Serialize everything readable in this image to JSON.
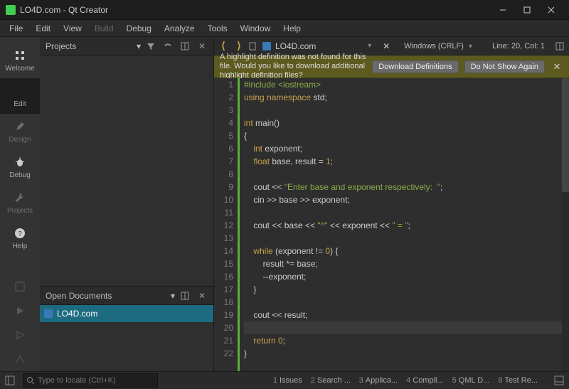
{
  "window": {
    "title": "LO4D.com - Qt Creator"
  },
  "menu": {
    "items": [
      "File",
      "Edit",
      "View",
      "Build",
      "Debug",
      "Analyze",
      "Tools",
      "Window",
      "Help"
    ],
    "disabled_index": 3
  },
  "sidebar": {
    "modes": [
      {
        "id": "welcome",
        "label": "Welcome",
        "icon": "grid-icon",
        "active": false,
        "disabled": false
      },
      {
        "id": "edit",
        "label": "Edit",
        "icon": "pencil-icon",
        "active": true,
        "disabled": false
      },
      {
        "id": "design",
        "label": "Design",
        "icon": "brush-icon",
        "active": false,
        "disabled": true
      },
      {
        "id": "debug",
        "label": "Debug",
        "icon": "bug-icon",
        "active": false,
        "disabled": false
      },
      {
        "id": "projects",
        "label": "Projects",
        "icon": "wrench-icon",
        "active": false,
        "disabled": true
      },
      {
        "id": "help",
        "label": "Help",
        "icon": "help-icon",
        "active": false,
        "disabled": false
      }
    ]
  },
  "projectsPanel": {
    "title": "Projects"
  },
  "openDocs": {
    "title": "Open Documents",
    "items": [
      {
        "name": "LO4D.com"
      }
    ]
  },
  "editor": {
    "filename": "LO4D.com",
    "encoding": "Windows (CRLF)",
    "cursor": "Line: 20, Col: 1",
    "current_line_index": 19
  },
  "notification": {
    "message": "A highlight definition was not found for this file. Would you like to download additional highlight definition files?",
    "btn_download": "Download Definitions",
    "btn_dismiss": "Do Not Show Again"
  },
  "code": {
    "lines": [
      {
        "n": 1,
        "tokens": [
          [
            "pp",
            "#include <iostream>"
          ]
        ]
      },
      {
        "n": 2,
        "tokens": [
          [
            "kw",
            "using namespace"
          ],
          [
            "op",
            " std;"
          ]
        ]
      },
      {
        "n": 3,
        "tokens": []
      },
      {
        "n": 4,
        "tokens": [
          [
            "kw",
            "int"
          ],
          [
            "op",
            " main()"
          ]
        ]
      },
      {
        "n": 5,
        "tokens": [
          [
            "op",
            "{"
          ]
        ]
      },
      {
        "n": 6,
        "tokens": [
          [
            "op",
            "    "
          ],
          [
            "kw",
            "int"
          ],
          [
            "op",
            " exponent;"
          ]
        ]
      },
      {
        "n": 7,
        "tokens": [
          [
            "op",
            "    "
          ],
          [
            "kw",
            "float"
          ],
          [
            "op",
            " base, result = "
          ],
          [
            "num",
            "1"
          ],
          [
            "op",
            ";"
          ]
        ]
      },
      {
        "n": 8,
        "tokens": []
      },
      {
        "n": 9,
        "tokens": [
          [
            "op",
            "    cout << "
          ],
          [
            "str",
            "\"Enter base and exponent respectively:  \""
          ],
          [
            "op",
            ";"
          ]
        ]
      },
      {
        "n": 10,
        "tokens": [
          [
            "op",
            "    cin >> base >> exponent;"
          ]
        ]
      },
      {
        "n": 11,
        "tokens": []
      },
      {
        "n": 12,
        "tokens": [
          [
            "op",
            "    cout << base << "
          ],
          [
            "str",
            "\"^\""
          ],
          [
            "op",
            " << exponent << "
          ],
          [
            "str",
            "\" = \""
          ],
          [
            "op",
            ";"
          ]
        ]
      },
      {
        "n": 13,
        "tokens": []
      },
      {
        "n": 14,
        "tokens": [
          [
            "op",
            "    "
          ],
          [
            "kw",
            "while"
          ],
          [
            "op",
            " (exponent != "
          ],
          [
            "num",
            "0"
          ],
          [
            "op",
            ") {"
          ]
        ]
      },
      {
        "n": 15,
        "tokens": [
          [
            "op",
            "        result *= base;"
          ]
        ]
      },
      {
        "n": 16,
        "tokens": [
          [
            "op",
            "        --exponent;"
          ]
        ]
      },
      {
        "n": 17,
        "tokens": [
          [
            "op",
            "    }"
          ]
        ]
      },
      {
        "n": 18,
        "tokens": []
      },
      {
        "n": 19,
        "tokens": [
          [
            "op",
            "    cout << result;"
          ]
        ]
      },
      {
        "n": 20,
        "tokens": []
      },
      {
        "n": 21,
        "tokens": [
          [
            "op",
            "    "
          ],
          [
            "kw",
            "return"
          ],
          [
            "op",
            " "
          ],
          [
            "num",
            "0"
          ],
          [
            "op",
            ";"
          ]
        ]
      },
      {
        "n": 22,
        "tokens": [
          [
            "op",
            "}"
          ]
        ]
      }
    ]
  },
  "bottombar": {
    "search_placeholder": "Type to locate (Ctrl+K)",
    "tabs": [
      {
        "num": "1",
        "label": "Issues"
      },
      {
        "num": "2",
        "label": "Search ..."
      },
      {
        "num": "3",
        "label": "Applica..."
      },
      {
        "num": "4",
        "label": "Compil..."
      },
      {
        "num": "5",
        "label": "QML D..."
      },
      {
        "num": "8",
        "label": "Test Re..."
      }
    ]
  }
}
